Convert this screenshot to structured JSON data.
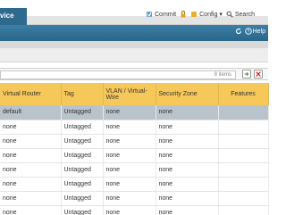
{
  "header": {
    "active_tab": "Device",
    "tab_fragment": "vice",
    "links": {
      "commit": "Commit",
      "config": "Config",
      "search": "Search"
    }
  },
  "navbar": {
    "help": "Help"
  },
  "table": {
    "items_count": "8 items",
    "columns": [
      "Virtual Router",
      "Tag",
      "VLAN / Virtual-Wire",
      "Security Zone",
      "Features"
    ],
    "rows": [
      [
        "default",
        "Untagged",
        "none",
        "none",
        ""
      ],
      [
        "none",
        "Untagged",
        "none",
        "none",
        ""
      ],
      [
        "none",
        "Untagged",
        "none",
        "none",
        ""
      ],
      [
        "none",
        "Untagged",
        "none",
        "none",
        ""
      ],
      [
        "none",
        "Untagged",
        "none",
        "none",
        ""
      ],
      [
        "none",
        "Untagged",
        "none",
        "none",
        ""
      ],
      [
        "none",
        "Untagged",
        "none",
        "none",
        ""
      ],
      [
        "none",
        "Untagged",
        "none",
        "none",
        ""
      ]
    ]
  },
  "colors": {
    "accent": "#2e6a8e",
    "header_row": "#f6c85a",
    "selected_row": "#b9c3cb"
  }
}
